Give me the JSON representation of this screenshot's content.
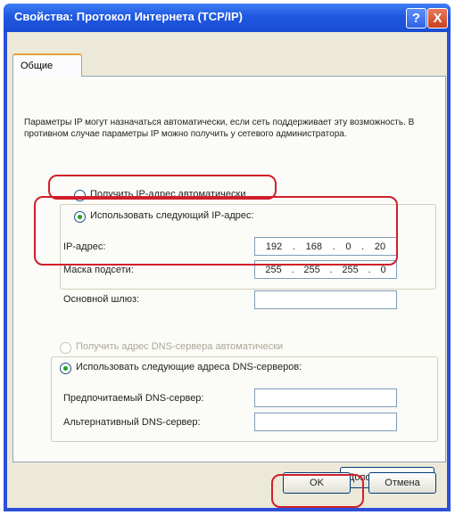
{
  "window": {
    "title": "Свойства: Протокол Интернета (TCP/IP)",
    "help_label": "?",
    "close_label": "X"
  },
  "tabs": [
    {
      "label": "Общие",
      "active": true
    }
  ],
  "description": "Параметры IP могут назначаться автоматически, если сеть поддерживает эту возможность. В противном случае параметры IP можно получить у сетевого администратора.",
  "ip_mode": {
    "auto_label": "Получить IP-адрес автоматически",
    "manual_label": "Использовать следующий IP-адрес:",
    "selected": "manual"
  },
  "ip_fields": {
    "ip_label": "IP-адрес:",
    "ip_value": [
      "192",
      "168",
      "0",
      "20"
    ],
    "mask_label": "Маска подсети:",
    "mask_value": [
      "255",
      "255",
      "255",
      "0"
    ],
    "gateway_label": "Основной шлюз:"
  },
  "dns_mode": {
    "auto_label": "Получить адрес DNS-сервера автоматически",
    "manual_label": "Использовать следующие адреса DNS-серверов:",
    "selected": "manual"
  },
  "dns_fields": {
    "preferred_label": "Предпочитаемый DNS-сервер:",
    "alternate_label": "Альтернативный DNS-сервер:"
  },
  "buttons": {
    "advanced": "Дополнительно...",
    "ok": "OK",
    "cancel": "Отмена"
  },
  "colors": {
    "titlebar": "#1f57e0",
    "highlight": "#d01f2b",
    "radio_dot": "#21a121"
  }
}
